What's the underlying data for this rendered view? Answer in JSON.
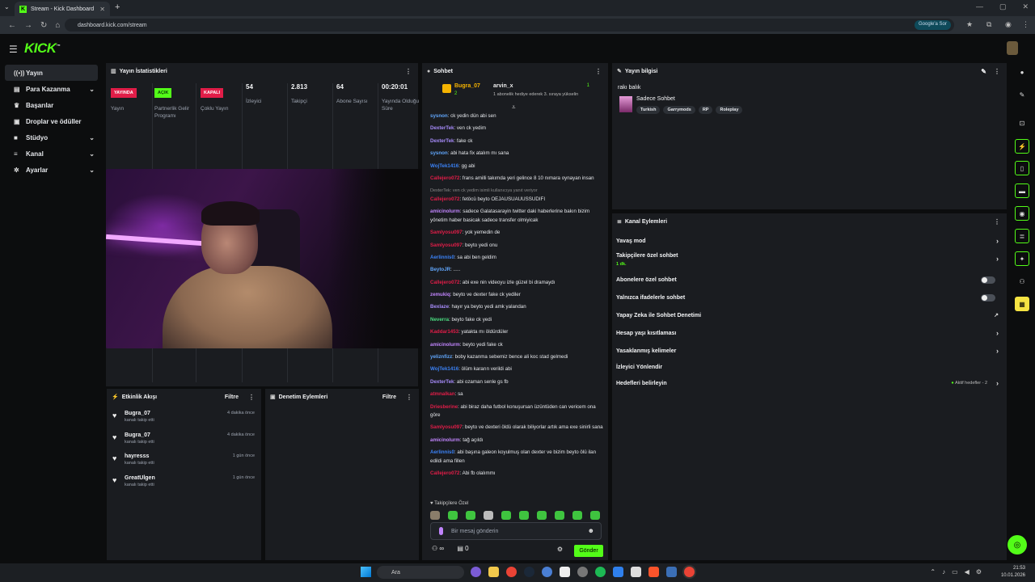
{
  "browser": {
    "tab_title": "Stream - Kick Dashboard",
    "url": "dashboard.kick.com/stream",
    "google_label": "Google'a Sor"
  },
  "brand": {
    "logo": "KICK",
    "accent": "#53fc18"
  },
  "sidebar": {
    "items": [
      {
        "label": "Yayın",
        "icon": "broadcast-icon"
      },
      {
        "label": "Para Kazanma",
        "icon": "money-icon"
      },
      {
        "label": "Başarılar",
        "icon": "trophy-icon"
      },
      {
        "label": "Droplar ve ödüller",
        "icon": "gift-icon"
      },
      {
        "label": "Stüdyo",
        "icon": "studio-icon"
      },
      {
        "label": "Kanal",
        "icon": "channel-icon"
      },
      {
        "label": "Ayarlar",
        "icon": "gear-icon"
      }
    ]
  },
  "stats": {
    "title": "Yayın İstatistikleri",
    "cols": [
      {
        "badge": "YAYINDA",
        "badge_color": "#e11d48",
        "label": "Yayın"
      },
      {
        "badge": "AÇIK",
        "badge_color": "#53fc18",
        "label": "Partnerlik Gelir Programı"
      },
      {
        "badge": "KAPALI",
        "badge_color": "#e11d48",
        "label": "Çoklu Yayın"
      },
      {
        "value": "54",
        "label": "İzleyici"
      },
      {
        "value": "2.813",
        "label": "Takipçi"
      },
      {
        "value": "64",
        "label": "Abone Sayısı"
      },
      {
        "value": "00:20:01",
        "label": "Yayında Olduğu Süre"
      }
    ]
  },
  "activity": {
    "title": "Etkinlik Akışı",
    "filter": "Filtre",
    "items": [
      {
        "name": "Bugra_07",
        "sub": "kanalı takip etti",
        "time": "4 dakika önce"
      },
      {
        "name": "Bugra_07",
        "sub": "kanalı takip etti",
        "time": "4 dakika önce"
      },
      {
        "name": "hayresss",
        "sub": "kanalı takip etti",
        "time": "1 gün önce"
      },
      {
        "name": "GreatUlgen",
        "sub": "kanalı takip etti",
        "time": "1 gün önce"
      }
    ]
  },
  "moderation": {
    "title": "Denetim Eylemleri",
    "filter": "Filtre"
  },
  "chat": {
    "title": "Sohbet",
    "pinned": {
      "user1": "Bugra_07",
      "count1": "2",
      "user2": "arvin_x",
      "count2": "1",
      "desc": "1 abonelik hediye ederek 3. sıraya yükselin"
    },
    "messages": [
      {
        "user": "sysnon",
        "color": "#60a5fa",
        "text": "ck yedin dün abi sen"
      },
      {
        "user": "DexterTek",
        "color": "#a78bfa",
        "text": "ven ck yedim"
      },
      {
        "user": "DexterTek",
        "color": "#a78bfa",
        "text": "fake ck"
      },
      {
        "user": "sysnon",
        "color": "#60a5fa",
        "text": "abi hata fix atalım mı sana"
      },
      {
        "user": "WojTek1416",
        "color": "#3b82f6",
        "text": "gg abi"
      },
      {
        "user": "Callejero072",
        "color": "#e11d48",
        "text": "frans amilli takımda yeri gelince 8 10 nımara oynayan insan"
      },
      {
        "user": "Callejero072",
        "color": "#e11d48",
        "reply": "DexterTek: ven ck yedim isimli kullanıcıya yanıt veriyor",
        "text": "fetöcü beyto OEJAUSUAUUSSUDIFI"
      },
      {
        "user": "amicinolurm",
        "color": "#c084fc",
        "text": "sadece Galatasarayin twitter daki haberlerine bakın bizim yönetim haber basicak sadece transfer olmiyicak"
      },
      {
        "user": "Samlyosu097",
        "color": "#e11d48",
        "text": "yok yemedin de"
      },
      {
        "user": "Samlyosu097",
        "color": "#e11d48",
        "text": "beyto yedi onu"
      },
      {
        "user": "Aerlinnis0",
        "color": "#3b82f6",
        "text": "sa abi ben geldim"
      },
      {
        "user": "BeytoJR",
        "color": "#60a5fa",
        "text": "....."
      },
      {
        "user": "Callejero072",
        "color": "#e11d48",
        "text": "abi exe nin videoyu izle güzel bi dramaydı"
      },
      {
        "user": "zemukiq",
        "color": "#c084fc",
        "text": "beyto ve dexter fake ck yediler"
      },
      {
        "user": "Bexlaze",
        "color": "#a78bfa",
        "text": "hayır ya beyto yedi amk yalandan"
      },
      {
        "user": "Neverra",
        "color": "#4ade80",
        "text": "beyto fake ck yedi"
      },
      {
        "user": "Kaddar1453",
        "color": "#e11d48",
        "text": "yatakta mı öldürdüler"
      },
      {
        "user": "amicinolurm",
        "color": "#c084fc",
        "text": "beyto yedi fake ck"
      },
      {
        "user": "yeliznfizz",
        "color": "#60a5fa",
        "text": "boby kazanma sebemiz bence ali koc stad gelmedi"
      },
      {
        "user": "WojTek1416",
        "color": "#3b82f6",
        "text": "ölüm kararın verildi abi"
      },
      {
        "user": "DexterTek",
        "color": "#a78bfa",
        "text": "abi ozaman senle gs fb"
      },
      {
        "user": "atmnalkan",
        "color": "#e11d48",
        "text": "sa"
      },
      {
        "user": "Driesberine",
        "color": "#e11d48",
        "text": "abi biraz daha futbol konuşursan üzüntüden can vericem ona göre"
      },
      {
        "user": "Samlyosu097",
        "color": "#e11d48",
        "text": "beyto ve dexteri öldü olarak biliyorlar artık ama exe sinirli sana"
      },
      {
        "user": "amicinolurm",
        "color": "#c084fc",
        "text": "tağ açıldı"
      },
      {
        "user": "Aerlinnis0",
        "color": "#3b82f6",
        "text": "abi başına galeon koyulmuş olan dexter ve bizim beyto ölü ilan edildi ama fillen"
      },
      {
        "user": "Callejero072",
        "color": "#e11d48",
        "text": "Abi fb olalımmı"
      }
    ],
    "followers_only": "Takipçilere Özel",
    "input_placeholder": "Bir mesaj gönderin",
    "infinity": "∞",
    "gift_count": "0",
    "send_label": "Gönder"
  },
  "stream_info": {
    "title": "Yayın bilgisi",
    "stream_title": "rakı balık",
    "category": "Sadece Sohbet",
    "tags": [
      "Turkish",
      "Garrymods",
      "RP",
      "Roleplay"
    ]
  },
  "channel_actions": {
    "title": "Kanal Eylemleri",
    "items": [
      {
        "label": "Yavaş mod",
        "type": "chevron"
      },
      {
        "label": "Takipçilere özel sohbet",
        "sub": "1 dk.",
        "type": "chevron"
      },
      {
        "label": "Abonelere özel sohbet",
        "type": "toggle"
      },
      {
        "label": "Yalnızca ifadelerle sohbet",
        "type": "toggle"
      },
      {
        "label": "Yapay Zeka ile Sohbet Denetimi",
        "type": "external"
      },
      {
        "label": "Hesap yaşı kısıtlaması",
        "type": "chevron"
      },
      {
        "label": "Yasaklanmış kelimeler",
        "type": "chevron"
      },
      {
        "label": "İzleyici Yönlendir",
        "type": "none"
      },
      {
        "label": "Hedefleri belirleyin",
        "type": "chevron",
        "extra": "Aktif hedefler - 2"
      }
    ]
  },
  "taskbar": {
    "search": "Ara",
    "time": "21:53",
    "date": "10.01.2026"
  }
}
